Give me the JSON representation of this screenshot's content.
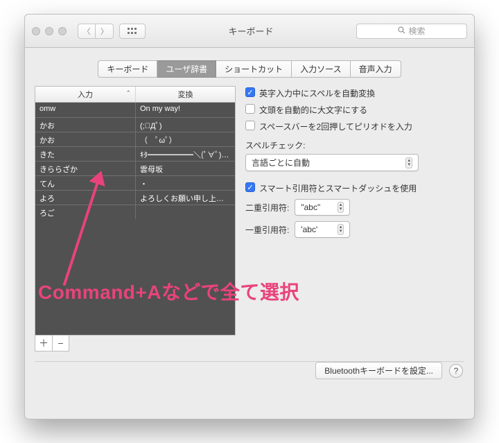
{
  "window": {
    "title": "キーボード"
  },
  "search": {
    "placeholder": "検索"
  },
  "tabs": [
    {
      "label": "キーボード",
      "key": "keyboard"
    },
    {
      "label": "ユーザ辞書",
      "key": "user-dict"
    },
    {
      "label": "ショートカット",
      "key": "shortcuts"
    },
    {
      "label": "入力ソース",
      "key": "input-sources"
    },
    {
      "label": "音声入力",
      "key": "dictation"
    }
  ],
  "active_tab": "user-dict",
  "table": {
    "columns": [
      "入力",
      "変換"
    ],
    "rows": [
      {
        "in": "omw",
        "out": "On my way!"
      },
      {
        "in": "かお",
        "out": "(;ﾟДﾟ)"
      },
      {
        "in": "かお",
        "out": "（　ﾟωﾟ）"
      },
      {
        "in": "きた",
        "out": "ｷﾀ━━━━━━＼(ﾟ∀ﾟ)／…"
      },
      {
        "in": "きららざか",
        "out": "雲母坂"
      },
      {
        "in": "てん",
        "out": "・"
      },
      {
        "in": "よろ",
        "out": "よろしくお願い申し上げま…"
      },
      {
        "in": "ろご",
        "out": ""
      }
    ]
  },
  "checkboxes": {
    "autocorrect": "英字入力中にスペルを自動変換",
    "capitalize": "文頭を自動的に大文字にする",
    "double_space_period": "スペースバーを2回押してピリオドを入力",
    "smart_quotes": "スマート引用符とスマートダッシュを使用"
  },
  "spellcheck": {
    "label": "スペルチェック:",
    "value": "言語ごとに自動"
  },
  "quotes": {
    "double_label": "二重引用符:",
    "double_value": "\"abc\"",
    "single_label": "一重引用符:",
    "single_value": "'abc'"
  },
  "footer": {
    "bluetooth": "Bluetoothキーボードを設定..."
  },
  "annotation": {
    "text": "Command+Aなどで全て選択"
  }
}
